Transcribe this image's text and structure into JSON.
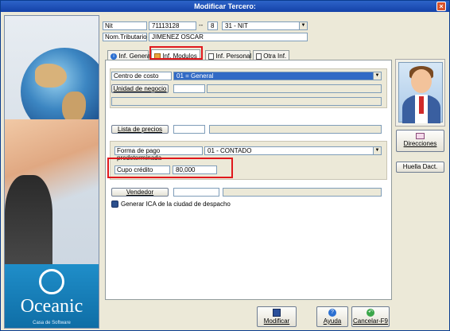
{
  "window": {
    "title": "Modificar Tercero:",
    "close_icon": "close-icon"
  },
  "header": {
    "nit_label": "Nit",
    "nit_value": "71113128",
    "dash": "--",
    "dv_value": "8",
    "doc_type": "31 - NIT",
    "nom_label": "Nom.Tributario",
    "nom_value": "JIMENEZ OSCAR"
  },
  "tabs": [
    {
      "label": "Inf. General",
      "icon": "info-icon"
    },
    {
      "label": "Inf. Modulos",
      "icon": "grid-icon"
    },
    {
      "label": "Inf. Personal",
      "icon": "document-icon"
    },
    {
      "label": "Otra Inf.",
      "icon": "document-icon"
    }
  ],
  "modulos": {
    "centro_costo_label": "Centro de costo",
    "centro_costo_value": "01 = General",
    "unidad_negocio_button": "Unidad de negocio",
    "unidad_negocio_value": "",
    "lista_precios_button": "Lista de precios",
    "lista_precios_value": "",
    "forma_pago_label": "Forma de pago predeterminada",
    "forma_pago_value": "01 - CONTADO",
    "cupo_credito_label": "Cupo crédito",
    "cupo_credito_value": "80,000",
    "vendedor_button": "Vendedor",
    "vendedor_value": "",
    "generar_ica_label": "Generar ICA de la ciudad de despacho"
  },
  "side": {
    "direcciones": "Direcciones",
    "huella": "Huella Dact."
  },
  "footer": {
    "modificar": "Modificar",
    "ayuda": "Ayuda",
    "cancelar": "Cancelar-F9"
  },
  "logo": {
    "name": "Oceanic",
    "tagline": "Casa de Software"
  },
  "colors": {
    "highlight": "#e0181c",
    "selection": "#316ac5",
    "title_bar": "#1442a8"
  }
}
